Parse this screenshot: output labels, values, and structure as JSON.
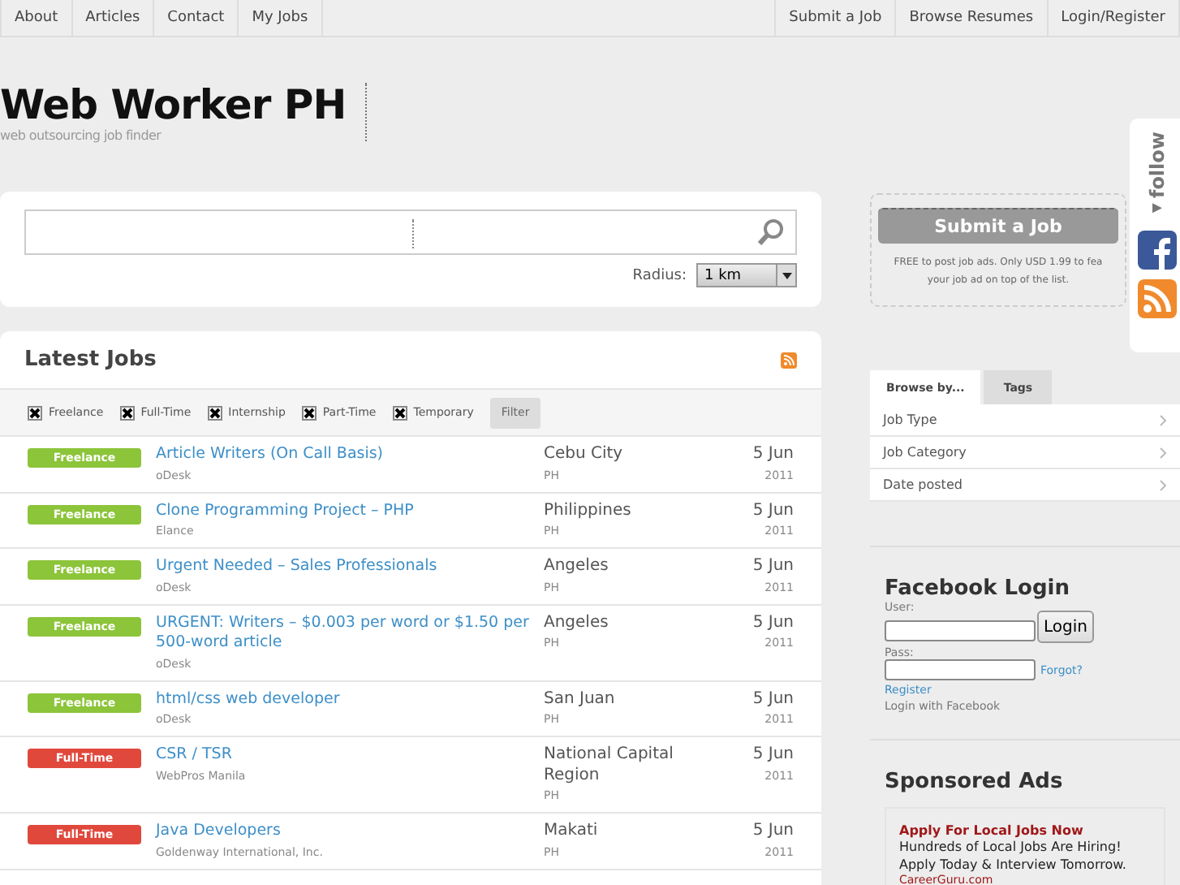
{
  "nav": {
    "left": [
      "About",
      "Articles",
      "Contact",
      "My Jobs"
    ],
    "right": [
      "Submit a Job",
      "Browse Resumes",
      "Login/Register"
    ]
  },
  "header": {
    "title": "Web Worker PH",
    "tagline": "web outsourcing job finder"
  },
  "search": {
    "radius_label": "Radius:",
    "radius_value": "1 km"
  },
  "latest_jobs": {
    "title": "Latest Jobs",
    "filters": [
      {
        "label": "Freelance",
        "checked": true
      },
      {
        "label": "Full-Time",
        "checked": true
      },
      {
        "label": "Internship",
        "checked": true
      },
      {
        "label": "Part-Time",
        "checked": true
      },
      {
        "label": "Temporary",
        "checked": true
      }
    ],
    "filter_button": "Filter",
    "rows": [
      {
        "type": "Freelance",
        "color": "#8cc43a",
        "title": "Article Writers (On Call Basis)",
        "company": "oDesk",
        "location": "Cebu City",
        "country": "PH",
        "day": "5 Jun",
        "year": "2011"
      },
      {
        "type": "Freelance",
        "color": "#8cc43a",
        "title": "Clone Programming Project – PHP",
        "company": "Elance",
        "location": "Philippines",
        "country": "PH",
        "day": "5 Jun",
        "year": "2011"
      },
      {
        "type": "Freelance",
        "color": "#8cc43a",
        "title": "Urgent Needed – Sales Professionals",
        "company": "oDesk",
        "location": "Angeles",
        "country": "PH",
        "day": "5 Jun",
        "year": "2011"
      },
      {
        "type": "Freelance",
        "color": "#8cc43a",
        "title": "URGENT: Writers – $0.003 per word or $1.50 per 500-word article",
        "company": "oDesk",
        "location": "Angeles",
        "country": "PH",
        "day": "5 Jun",
        "year": "2011"
      },
      {
        "type": "Freelance",
        "color": "#8cc43a",
        "title": "html/css web developer",
        "company": "oDesk",
        "location": "San Juan",
        "country": "PH",
        "day": "5 Jun",
        "year": "2011"
      },
      {
        "type": "Full-Time",
        "color": "#e0483c",
        "title": "CSR / TSR",
        "company": "WebPros Manila",
        "location": "National Capital Region",
        "country": "PH",
        "day": "5 Jun",
        "year": "2011"
      },
      {
        "type": "Full-Time",
        "color": "#e0483c",
        "title": "Java Developers",
        "company": "Goldenway International, Inc.",
        "location": "Makati",
        "country": "PH",
        "day": "5 Jun",
        "year": "2011"
      }
    ]
  },
  "submit_box": {
    "button": "Submit a Job",
    "note_lines": [
      "FREE to post job ads. Only USD 1.99 to fea",
      "your job ad on top of the list."
    ]
  },
  "follow": {
    "label": "◂follow"
  },
  "browse": {
    "tabs": [
      {
        "label": "Browse by...",
        "selected": true
      },
      {
        "label": "Tags",
        "selected": false
      }
    ],
    "items": [
      "Job Type",
      "Job Category",
      "Date posted"
    ]
  },
  "facebook_login": {
    "title": "Facebook Login",
    "user_label": "User:",
    "pass_label": "Pass:",
    "login_button": "Login",
    "forgot": "Forgot?",
    "register": "Register",
    "login_with": "Login with Facebook"
  },
  "sponsored": {
    "title": "Sponsored Ads",
    "ad_title": "Apply For Local Jobs Now",
    "ad_lines": [
      "Hundreds of Local Jobs Are Hiring!",
      "Apply Today & Interview Tomorrow."
    ],
    "ad_url": "CareerGuru.com"
  }
}
